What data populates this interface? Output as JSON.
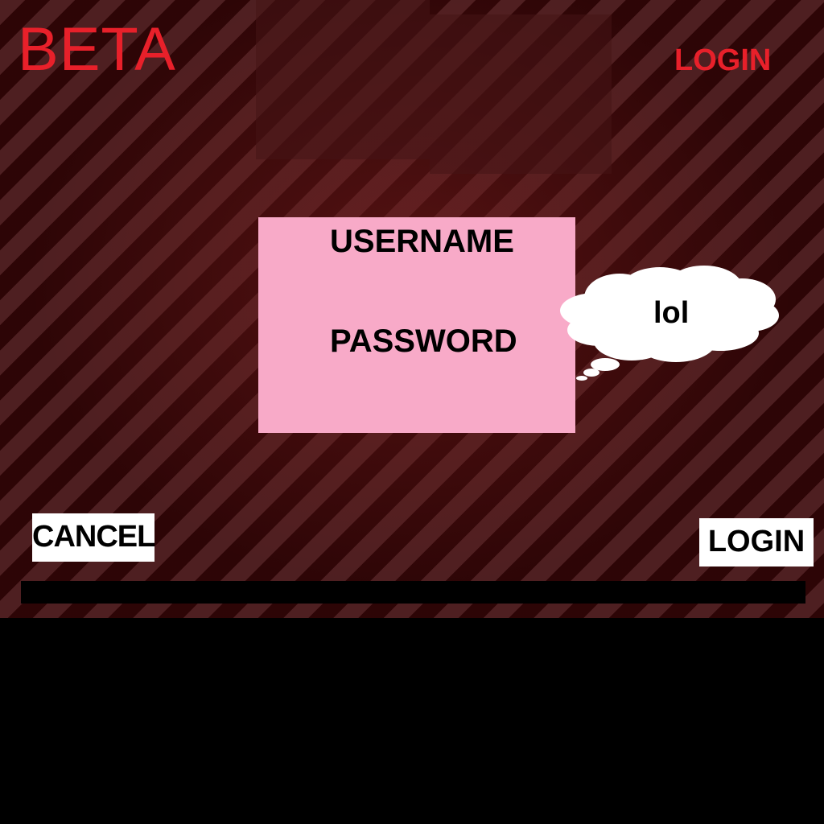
{
  "header": {
    "logo_text": "BETA",
    "login_link": "LOGIN"
  },
  "form": {
    "username_label": "USERNAME",
    "password_label": "PASSWORD"
  },
  "thought_bubble": {
    "text": "lol"
  },
  "buttons": {
    "cancel_label": "CANCEL",
    "login_label": "LOGIN"
  },
  "colors": {
    "accent_red": "#e8202a",
    "panel_pink": "#f8aac8",
    "background": "#3a0608"
  }
}
